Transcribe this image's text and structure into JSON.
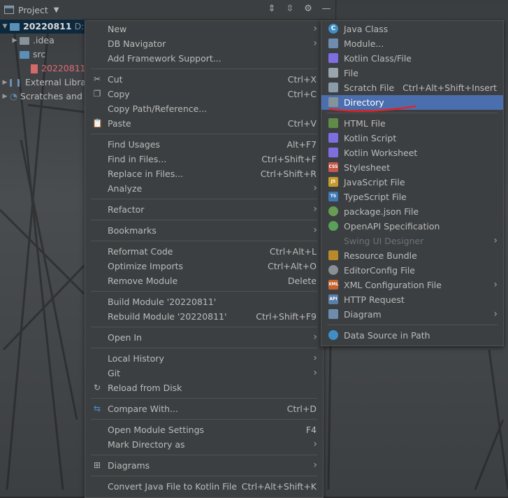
{
  "project_panel": {
    "title": "Project",
    "tree": [
      {
        "label": "20220811",
        "suffix": "D:"
      },
      {
        "label": ".idea"
      },
      {
        "label": "src"
      },
      {
        "label": "20220811"
      },
      {
        "label": "External Libra"
      },
      {
        "label": "Scratches and"
      }
    ]
  },
  "context_menu": {
    "items": [
      {
        "label": "New",
        "shortcut": "",
        "submenu": true
      },
      {
        "label": "DB Navigator",
        "shortcut": "",
        "submenu": true
      },
      {
        "label": "Add Framework Support...",
        "shortcut": ""
      },
      {
        "label": "Cut",
        "shortcut": "Ctrl+X",
        "icon": "scissors-icon"
      },
      {
        "label": "Copy",
        "shortcut": "Ctrl+C",
        "icon": "copy-icon"
      },
      {
        "label": "Copy Path/Reference...",
        "shortcut": ""
      },
      {
        "label": "Paste",
        "shortcut": "Ctrl+V",
        "icon": "paste-icon"
      },
      {
        "label": "Find Usages",
        "shortcut": "Alt+F7"
      },
      {
        "label": "Find in Files...",
        "shortcut": "Ctrl+Shift+F"
      },
      {
        "label": "Replace in Files...",
        "shortcut": "Ctrl+Shift+R"
      },
      {
        "label": "Analyze",
        "shortcut": "",
        "submenu": true
      },
      {
        "label": "Refactor",
        "shortcut": "",
        "submenu": true
      },
      {
        "label": "Bookmarks",
        "shortcut": "",
        "submenu": true
      },
      {
        "label": "Reformat Code",
        "shortcut": "Ctrl+Alt+L"
      },
      {
        "label": "Optimize Imports",
        "shortcut": "Ctrl+Alt+O"
      },
      {
        "label": "Remove Module",
        "shortcut": "Delete"
      },
      {
        "label": "Build Module '20220811'",
        "shortcut": ""
      },
      {
        "label": "Rebuild Module '20220811'",
        "shortcut": "Ctrl+Shift+F9"
      },
      {
        "label": "Open In",
        "shortcut": "",
        "submenu": true
      },
      {
        "label": "Local History",
        "shortcut": "",
        "submenu": true
      },
      {
        "label": "Git",
        "shortcut": "",
        "submenu": true
      },
      {
        "label": "Reload from Disk",
        "shortcut": "",
        "icon": "reload-icon"
      },
      {
        "label": "Compare With...",
        "shortcut": "Ctrl+D",
        "icon": "compare-icon"
      },
      {
        "label": "Open Module Settings",
        "shortcut": "F4"
      },
      {
        "label": "Mark Directory as",
        "shortcut": "",
        "submenu": true
      },
      {
        "label": "Diagrams",
        "shortcut": "",
        "submenu": true,
        "icon": "diagram-icon"
      },
      {
        "label": "Convert Java File to Kotlin File",
        "shortcut": "Ctrl+Alt+Shift+K"
      }
    ]
  },
  "new_submenu": {
    "items": [
      {
        "label": "Java Class",
        "icon": "java-class-icon",
        "icon_text": "C"
      },
      {
        "label": "Module...",
        "icon": "module-icon"
      },
      {
        "label": "Kotlin Class/File",
        "icon": "kotlin-icon"
      },
      {
        "label": "File",
        "icon": "file-icon"
      },
      {
        "label": "Scratch File",
        "shortcut": "Ctrl+Alt+Shift+Insert",
        "icon": "scratch-file-icon"
      },
      {
        "label": "Directory",
        "icon": "folder-icon",
        "highlighted": true
      },
      {
        "label": "HTML File",
        "icon": "html-file-icon"
      },
      {
        "label": "Kotlin Script",
        "icon": "kotlin-script-icon"
      },
      {
        "label": "Kotlin Worksheet",
        "icon": "kotlin-worksheet-icon"
      },
      {
        "label": "Stylesheet",
        "icon": "css-file-icon",
        "icon_text": "CSS"
      },
      {
        "label": "JavaScript File",
        "icon": "js-file-icon",
        "icon_text": "JS"
      },
      {
        "label": "TypeScript File",
        "icon": "ts-file-icon",
        "icon_text": "TS"
      },
      {
        "label": "package.json File",
        "icon": "package-json-icon"
      },
      {
        "label": "OpenAPI Specification",
        "icon": "openapi-icon"
      },
      {
        "label": "Swing UI Designer",
        "submenu": true,
        "disabled": true
      },
      {
        "label": "Resource Bundle",
        "icon": "resource-bundle-icon"
      },
      {
        "label": "EditorConfig File",
        "icon": "editorconfig-icon"
      },
      {
        "label": "XML Configuration File",
        "submenu": true,
        "icon": "xml-file-icon",
        "icon_text": "XML"
      },
      {
        "label": "HTTP Request",
        "icon": "http-request-icon",
        "icon_text": "API"
      },
      {
        "label": "Diagram",
        "submenu": true,
        "icon": "diagram-icon"
      },
      {
        "label": "Data Source in Path",
        "icon": "database-icon"
      }
    ]
  },
  "colors": {
    "menu_bg": "#3c3f41",
    "highlight": "#4b6eaf",
    "annotation_underline": "#e0252b"
  }
}
